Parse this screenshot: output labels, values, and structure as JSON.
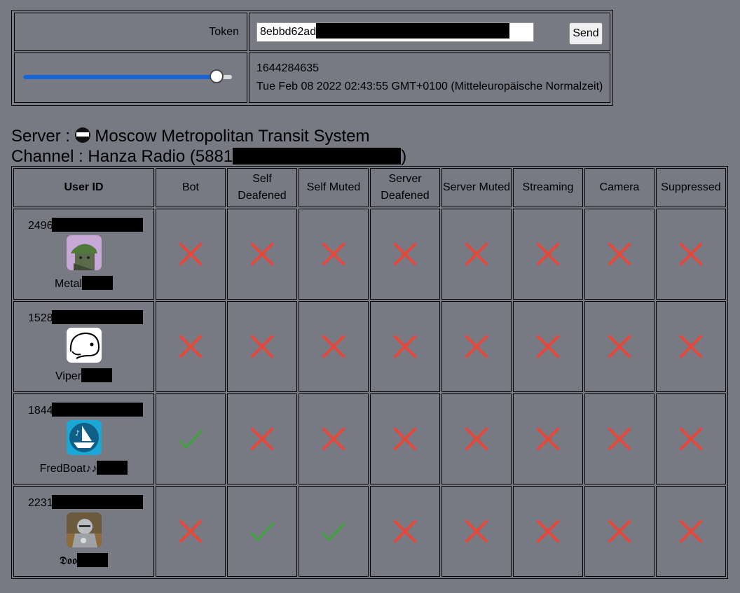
{
  "control": {
    "token_label": "Token",
    "token_value": "8ebbd62ad",
    "send_label": "Send",
    "slider_value": 0.92,
    "timestamp": "1644284635",
    "datetime": "Tue Feb 08 2022 02:43:55 GMT+0100 (Mitteleuropäische Normalzeit)"
  },
  "server": {
    "server_prefix": "Server :",
    "server_name": "Moscow Metropolitan Transit System",
    "channel_prefix": "Channel :",
    "channel_name": "Hanza Radio (5881",
    "channel_suffix": ")"
  },
  "table": {
    "headers": [
      "User ID",
      "Bot",
      "Self Deafened",
      "Self Muted",
      "Server Deafened",
      "Server Muted",
      "Streaming",
      "Camera",
      "Suppressed"
    ],
    "rows": [
      {
        "id": "2496",
        "name": "Metal",
        "avatar": "green-cap-avatar",
        "flags": [
          false,
          false,
          false,
          false,
          false,
          false,
          false,
          false
        ]
      },
      {
        "id": "1528",
        "name": "Viper",
        "avatar": "doodle-face-avatar",
        "flags": [
          false,
          false,
          false,
          false,
          false,
          false,
          false,
          false
        ]
      },
      {
        "id": "1844",
        "name": "FredBoat♪♪",
        "avatar": "boat-music-avatar",
        "flags": [
          true,
          false,
          false,
          false,
          false,
          false,
          false,
          false
        ]
      },
      {
        "id": "2231",
        "name": "𝕯𝖔𝖔",
        "avatar": "knight-armor-avatar",
        "flags": [
          false,
          true,
          true,
          false,
          false,
          false,
          false,
          false
        ]
      }
    ]
  },
  "icons": {
    "yes": "check-icon",
    "no": "cross-icon",
    "yes_color": "#3aa33a",
    "no_color": "#e5473b"
  }
}
